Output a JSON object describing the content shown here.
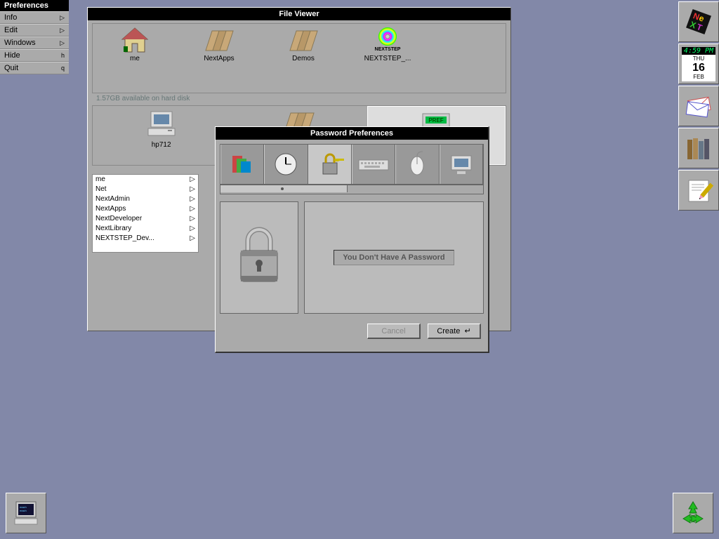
{
  "menu": {
    "title": "Preferences",
    "items": [
      {
        "label": "Info",
        "key": "▷"
      },
      {
        "label": "Edit",
        "key": "▷"
      },
      {
        "label": "Windows",
        "key": "▷"
      },
      {
        "label": "Hide",
        "key": "h"
      },
      {
        "label": "Quit",
        "key": "q"
      }
    ]
  },
  "file_viewer": {
    "title": "File Viewer",
    "shelf": [
      {
        "label": "me",
        "icon": "home"
      },
      {
        "label": "NextApps",
        "icon": "folder"
      },
      {
        "label": "Demos",
        "icon": "folder"
      },
      {
        "label": "NEXTSTEP_...",
        "icon": "cd"
      }
    ],
    "disk_info": "1.57GB available on hard disk",
    "browser_path": [
      {
        "label": "hp712",
        "icon": "computer"
      },
      {
        "label": "",
        "icon": "folder"
      },
      {
        "label": "",
        "icon": "pref-app"
      }
    ],
    "list": [
      {
        "label": "me",
        "arrow": "▷"
      },
      {
        "label": "Net",
        "arrow": "▷"
      },
      {
        "label": "NextAdmin",
        "arrow": "▷"
      },
      {
        "label": "NextApps",
        "arrow": "▷",
        "selected": true
      },
      {
        "label": "NextDeveloper",
        "arrow": "▷"
      },
      {
        "label": "NextLibrary",
        "arrow": "▷"
      },
      {
        "label": "NEXTSTEP_Dev...",
        "arrow": "▷"
      }
    ]
  },
  "pref_window": {
    "title": "Password Preferences",
    "tabs": [
      "display",
      "clock",
      "password",
      "keyboard",
      "mouse",
      "monitor"
    ],
    "active_tab": 2,
    "message": "You Don't Have A Password",
    "cancel_label": "Cancel",
    "create_label": "Create"
  },
  "dock": {
    "time": "4:59 PM",
    "day_name": "THU",
    "day_num": "16",
    "month": "FEB"
  },
  "pref_badge": "PREF"
}
